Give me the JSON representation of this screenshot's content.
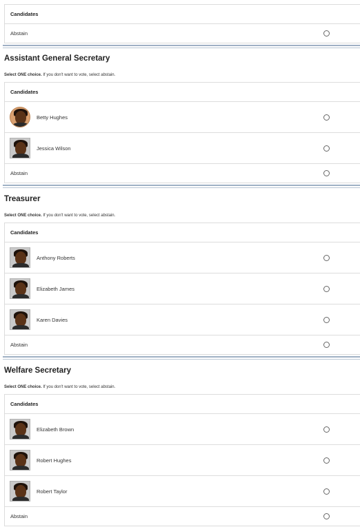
{
  "top": {
    "header": "Candidates",
    "abstain": "Abstain"
  },
  "sections": [
    {
      "title": "Assistant General Secretary",
      "instr_bold": "Select ONE choice.",
      "instr_rest": "If you don't want to vote, select abstain.",
      "header": "Candidates",
      "candidates": [
        "Betty Hughes",
        "Jessica Wilson"
      ],
      "abstain": "Abstain"
    },
    {
      "title": "Treasurer",
      "instr_bold": "Select ONE choice.",
      "instr_rest": "If you don't want to vote, select abstain.",
      "header": "Candidates",
      "candidates": [
        "Anthony Roberts",
        "Elizabeth James",
        "Karen Davies"
      ],
      "abstain": "Abstain"
    },
    {
      "title": "Welfare Secretary",
      "instr_bold": "Select ONE choice.",
      "instr_rest": "If you don't want to vote, select abstain.",
      "header": "Candidates",
      "candidates": [
        "Elizabeth Brown",
        "Robert Hughes",
        "Robert Taylor"
      ],
      "abstain": "Abstain"
    }
  ]
}
